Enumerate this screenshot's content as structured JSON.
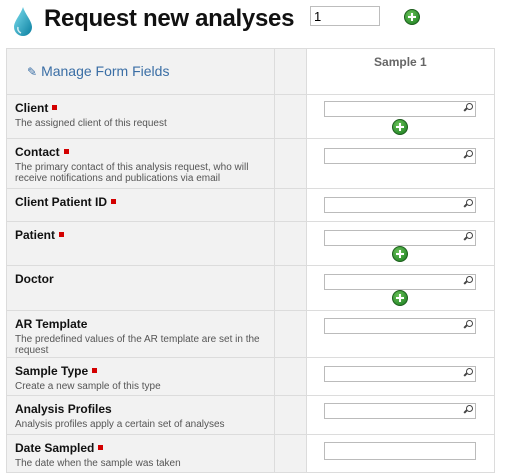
{
  "header": {
    "title": "Request new analyses",
    "count_value": "1",
    "logo_icon": "water-drop-icon",
    "add_icon": "plus-circle-icon"
  },
  "form": {
    "manage_label": "Manage Form Fields",
    "manage_icon": "pencil-icon",
    "sample_header": "Sample 1",
    "required_color": "#d30000",
    "fields": [
      {
        "name": "Client",
        "desc": "The assigned client of this request",
        "required": true
      },
      {
        "name": "Contact",
        "desc": "The primary contact of this analysis request, who will receive notifications and publications via email",
        "required": true
      },
      {
        "name": "Client Patient ID",
        "desc": "",
        "required": true
      },
      {
        "name": "Patient",
        "desc": "",
        "required": true
      },
      {
        "name": "Doctor",
        "desc": "",
        "required": false
      },
      {
        "name": "AR Template",
        "desc": "The predefined values of the AR template are set in the request",
        "required": false
      },
      {
        "name": "Sample Type",
        "desc": "Create a new sample of this type",
        "required": true
      },
      {
        "name": "Analysis Profiles",
        "desc": "Analysis profiles apply a certain set of analyses",
        "required": false
      },
      {
        "name": "Date Sampled",
        "desc": "The date when the sample was taken",
        "required": true
      }
    ]
  }
}
